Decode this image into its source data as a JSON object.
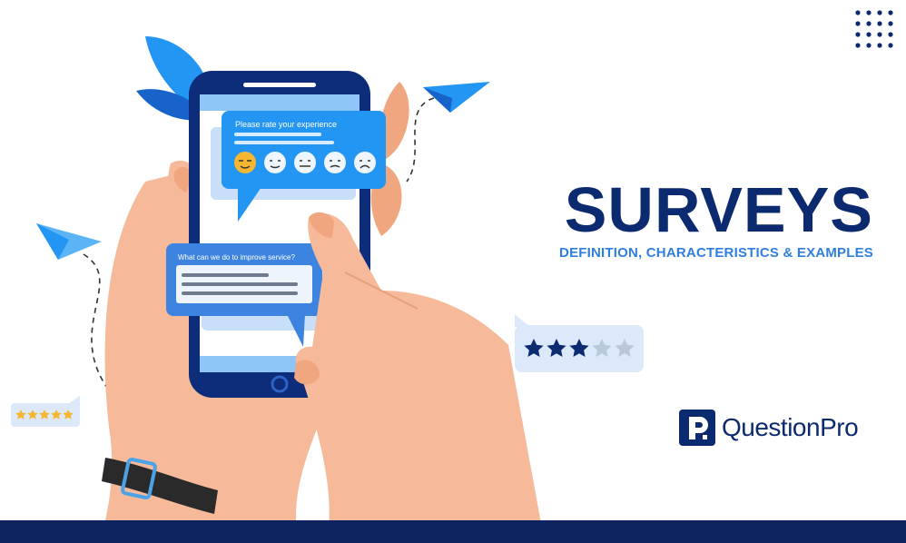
{
  "headline": {
    "title": "SURVEYS",
    "subtitle": "DEFINITION, CHARACTERISTICS & EXAMPLES"
  },
  "phone": {
    "rating_prompt": "Please rate your experience",
    "feedback_prompt": "What can we do to improve service?",
    "emoji_faces": [
      "laughing-face",
      "smiling-face",
      "neutral-face",
      "unhappy-face",
      "sad-face"
    ]
  },
  "rating_badges": {
    "large": {
      "filled": 3,
      "total": 5
    },
    "small": {
      "filled": 5,
      "total": 5
    }
  },
  "brand": {
    "name": "QuestionPro"
  },
  "colors": {
    "navy": "#0b2a6f",
    "accent_blue": "#2f7fe0",
    "bubble_blue": "#2396f3",
    "skin": "#f6b99a",
    "star_gold": "#f5b731"
  }
}
